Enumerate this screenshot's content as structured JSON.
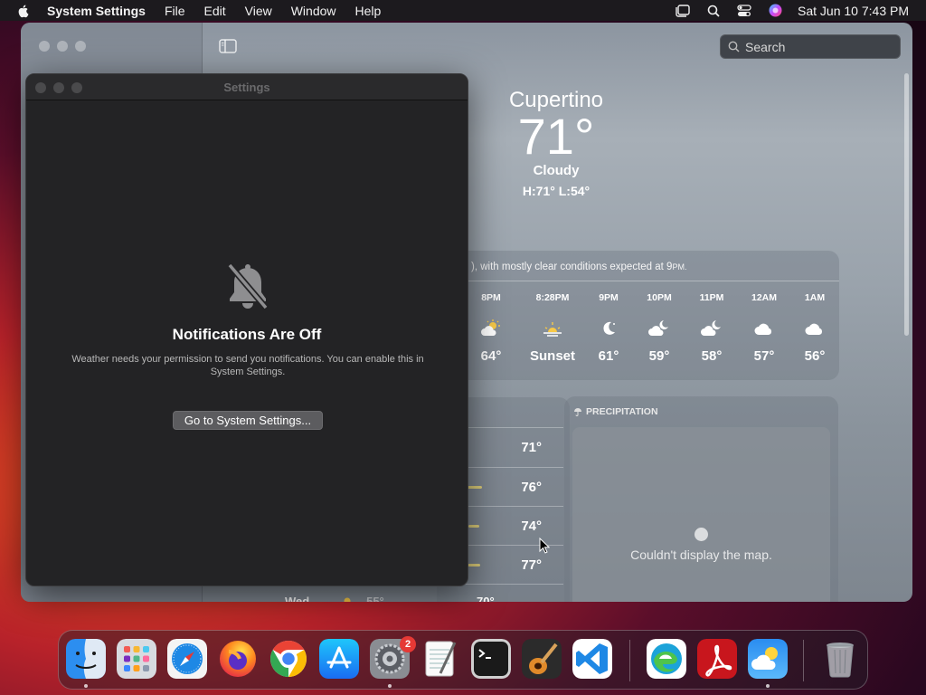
{
  "menubar": {
    "app_name": "System Settings",
    "items": [
      "File",
      "Edit",
      "View",
      "Window",
      "Help"
    ],
    "clock": "Sat Jun 10  7:43 PM"
  },
  "weather": {
    "search_placeholder": "Search",
    "city": "Cupertino",
    "temperature": "71°",
    "condition": "Cloudy",
    "hilo": "H:71°  L:54°",
    "summary_prefix": "), with mostly clear conditions expected at 9",
    "summary_suffix": "PM.",
    "hourly": [
      {
        "time": "8PM",
        "icon": "sun-cloud-icon",
        "temp": "64°"
      },
      {
        "time": "8:28PM",
        "icon": "sunset-icon",
        "temp": "Sunset"
      },
      {
        "time": "9PM",
        "icon": "moon-icon",
        "temp": "61°"
      },
      {
        "time": "10PM",
        "icon": "moon-cloud-icon",
        "temp": "59°"
      },
      {
        "time": "11PM",
        "icon": "moon-cloud-icon",
        "temp": "58°"
      },
      {
        "time": "12AM",
        "icon": "cloud-icon",
        "temp": "57°"
      },
      {
        "time": "1AM",
        "icon": "cloud-icon",
        "temp": "56°"
      }
    ],
    "daily_highs": [
      "71°",
      "76°",
      "74°",
      "77°"
    ],
    "partial_row": "Wed",
    "partial_low": "55°",
    "partial_high": "70°",
    "precip_title": "PRECIPITATION",
    "map_message": "Couldn't display the map."
  },
  "dialog": {
    "title": "Settings",
    "heading": "Notifications Are Off",
    "message_line1": "Weather needs your permission to send you notifications. You can enable this in",
    "message_line2": "System Settings.",
    "button_label": "Go to System Settings..."
  },
  "dock": {
    "apps": [
      "Finder",
      "Launchpad",
      "Safari",
      "Firefox",
      "Chrome",
      "App Store",
      "System Settings",
      "TextEdit",
      "Terminal",
      "GarageBand",
      "Visual Studio Code",
      "Microsoft Edge",
      "Adobe Acrobat",
      "Weather",
      "Trash"
    ],
    "settings_badge": "2"
  }
}
